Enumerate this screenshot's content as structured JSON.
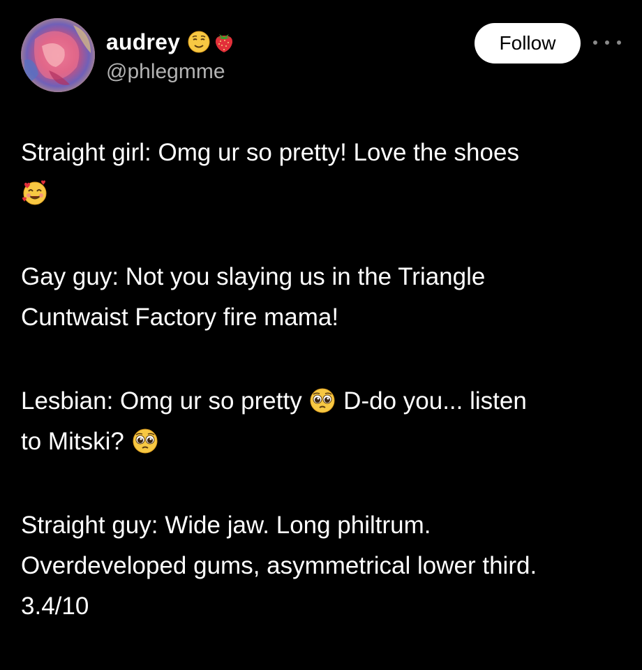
{
  "post": {
    "author": {
      "display_name": "audrey",
      "handle": "@phlegmme",
      "name_emojis": [
        "relieved-face-emoji",
        "strawberry-emoji"
      ]
    },
    "follow_label": "Follow",
    "more_icon": "more-dots-icon",
    "paragraphs": [
      {
        "text_before": "Straight girl: Omg ur so pretty! Love the shoes",
        "emoji": "smiling-face-with-hearts-emoji"
      },
      {
        "line1": "Gay guy: Not you slaying us in the Triangle",
        "line2": "Cuntwaist Factory fire mama!"
      },
      {
        "part1": "Lesbian: Omg ur so pretty",
        "part2": "D-do you... listen",
        "part3": "to Mitski?",
        "emoji": "pleading-face-emoji"
      },
      {
        "line1": "Straight guy: Wide jaw. Long philtrum.",
        "line2": "Overdeveloped gums, asymmetrical lower third.",
        "line3": "3.4/10"
      }
    ]
  },
  "colors": {
    "background": "#000000",
    "text": "#ffffff",
    "handle": "#b3b3b3",
    "follow_bg": "#ffffff",
    "follow_text": "#000000"
  }
}
